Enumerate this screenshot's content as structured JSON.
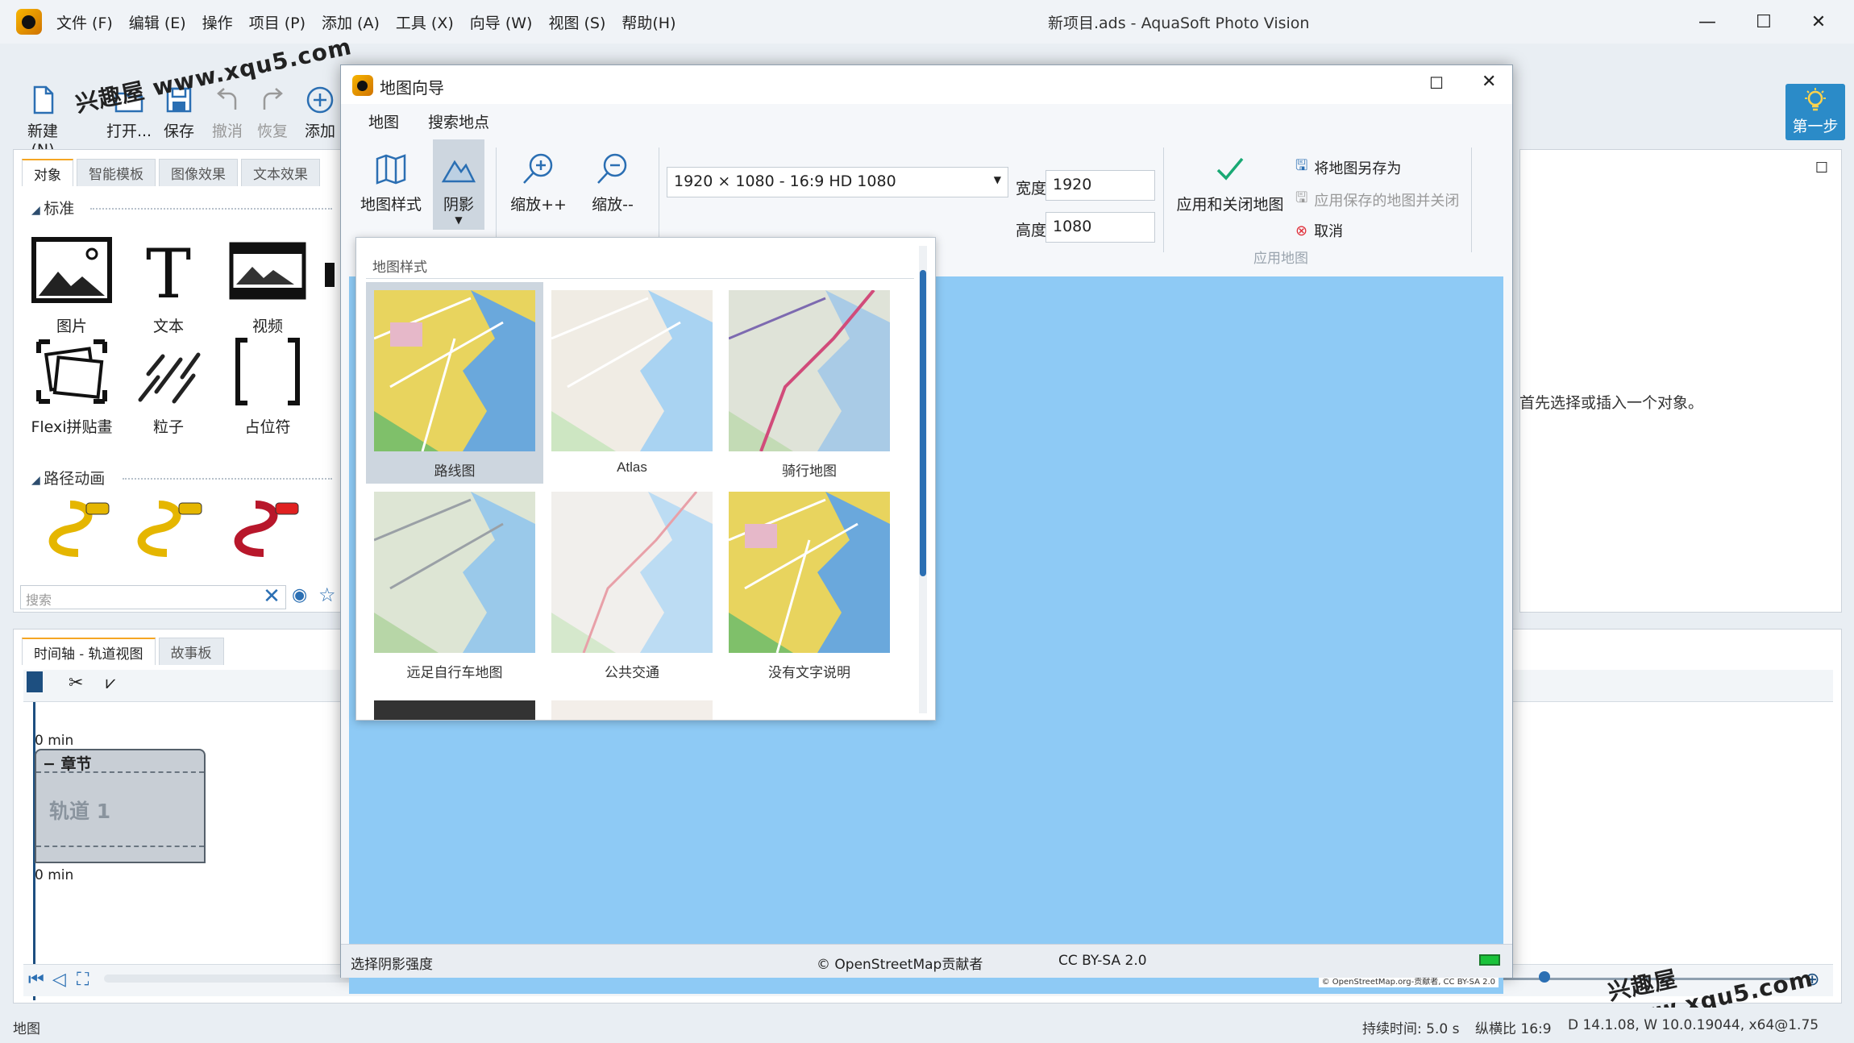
{
  "app": {
    "window_title": "新项目.ads - AquaSoft Photo Vision",
    "menu": [
      "文件 (F)",
      "编辑 (E)",
      "操作",
      "项目 (P)",
      "添加 (A)",
      "工具 (X)",
      "向导 (W)",
      "视图 (S)",
      "帮助(H)"
    ]
  },
  "ribbon": {
    "new": "新建 (N)",
    "open": "打开...",
    "save": "保存",
    "undo": "撤消",
    "redo": "恢复",
    "add": "添加",
    "step": "第一步"
  },
  "watermark": "兴趣屋 www.xqu5.com",
  "left_panel": {
    "tabs": [
      "对象",
      "智能模板",
      "图像效果",
      "文本效果",
      "..."
    ],
    "section_standard": "标准",
    "objects": [
      "图片",
      "文本",
      "视频",
      "Flexi拼贴畫",
      "粒子",
      "占位符"
    ],
    "section_path": "路径动画",
    "search_placeholder": "搜索"
  },
  "right_panel": {
    "message": "首先选择或插入一个对象。"
  },
  "timeline": {
    "tabs": [
      "时间轴 - 轨道视图",
      "故事板"
    ],
    "minutes_label": "0 min",
    "chapter": "章节",
    "track": "轨道 1"
  },
  "statusbar": {
    "left": "地图",
    "duration": "持续时间:  5.0 s",
    "aspect": "纵横比  16:9",
    "info": "D 14.1.08, W 10.0.19044, x64@1.75"
  },
  "dialog": {
    "title": "地图向导",
    "tabs": [
      "地图",
      "搜索地点"
    ],
    "map_style": "地图样式",
    "shadow": "阴影",
    "zoom_in": "缩放++",
    "zoom_out": "缩放--",
    "resolution": "1920 × 1080 - 16:9 HD 1080",
    "width_label": "宽度",
    "width_value": "1920",
    "height_label": "高度",
    "height_value": "1080",
    "apply_close": "应用和关闭地图",
    "save_map_as": "将地图另存为",
    "apply_saved_close": "应用保存的地图并关闭",
    "cancel": "取消",
    "group_apply": "应用地图",
    "status_hint": "选择阴影强度",
    "status_osm": "© OpenStreetMap贡献者",
    "status_license": "CC BY-SA 2.0",
    "osm_small": "© OpenStreetMap.org-贡献者, CC BY-SA 2.0"
  },
  "style_popup": {
    "heading": "地图样式",
    "styles": [
      "路线图",
      "Atlas",
      "骑行地图",
      "远足自行车地图",
      "公共交通",
      "没有文字说明"
    ]
  },
  "colors": {
    "accent": "#2b8bc8",
    "map_water": "#8ecaf5",
    "tab_highlight": "#f5a623",
    "scrollbar": "#2b6fb3"
  }
}
